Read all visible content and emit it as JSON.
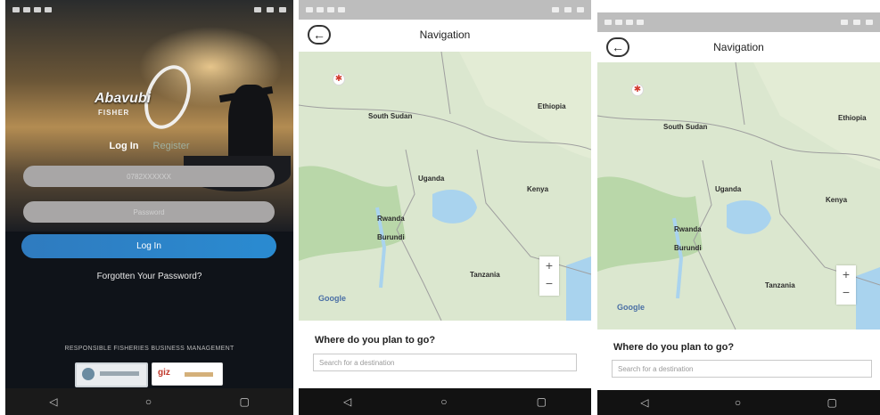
{
  "login_screen": {
    "brand": "Abavubi",
    "brand_sub": "FISHER",
    "tab_login": "Log In",
    "tab_register": "Register",
    "phone_placeholder": "0782XXXXXX",
    "password_placeholder": "Password",
    "login_button": "Log In",
    "forgot_link": "Forgotten Your Password?",
    "tagline": "RESPONSIBLE FISHERIES BUSINESS MANAGEMENT",
    "sponsor_giz": "giz"
  },
  "nav_screen_a": {
    "title": "Navigation",
    "back_icon": "←",
    "map_labels": {
      "south_sudan": "South Sudan",
      "ethiopia": "Ethiopia",
      "uganda": "Uganda",
      "kenya": "Kenya",
      "rwanda": "Rwanda",
      "burundi": "Burundi",
      "tanzania": "Tanzania"
    },
    "zoom_in": "+",
    "zoom_out": "−",
    "google": "Google",
    "question": "Where do you plan to go?",
    "search_placeholder": "Search for a destination"
  },
  "nav_screen_b": {
    "title": "Navigation",
    "back_icon": "←",
    "map_labels": {
      "south_sudan": "South Sudan",
      "ethiopia": "Ethiopia",
      "uganda": "Uganda",
      "kenya": "Kenya",
      "rwanda": "Rwanda",
      "burundi": "Burundi",
      "tanzania": "Tanzania"
    },
    "zoom_in": "+",
    "zoom_out": "−",
    "google": "Google",
    "question": "Where do you plan to go?",
    "search_placeholder": "Search for a destination"
  },
  "android_nav": {
    "back": "◁",
    "home": "○",
    "recent": "▢"
  },
  "colors": {
    "login_button": "#2a84c9",
    "map_land": "#d9e6cc",
    "map_water": "#a9d3ee",
    "pin": "#d23a2f"
  }
}
